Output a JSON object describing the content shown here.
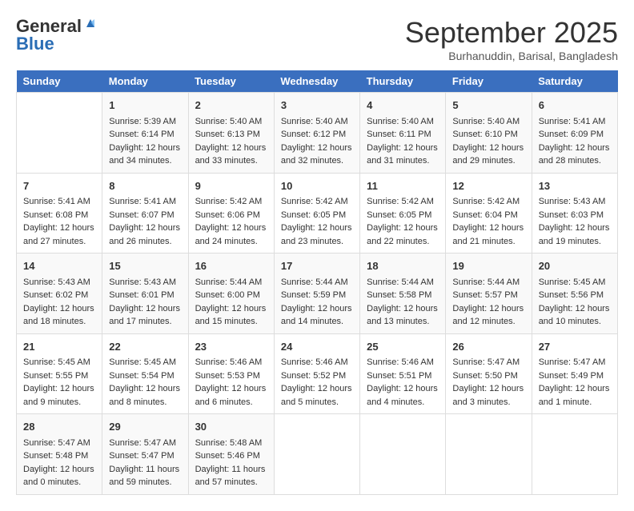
{
  "header": {
    "logo_general": "General",
    "logo_blue": "Blue",
    "month": "September 2025",
    "location": "Burhanuddin, Barisal, Bangladesh"
  },
  "columns": [
    "Sunday",
    "Monday",
    "Tuesday",
    "Wednesday",
    "Thursday",
    "Friday",
    "Saturday"
  ],
  "weeks": [
    [
      {
        "day": "",
        "info": ""
      },
      {
        "day": "1",
        "info": "Sunrise: 5:39 AM\nSunset: 6:14 PM\nDaylight: 12 hours\nand 34 minutes."
      },
      {
        "day": "2",
        "info": "Sunrise: 5:40 AM\nSunset: 6:13 PM\nDaylight: 12 hours\nand 33 minutes."
      },
      {
        "day": "3",
        "info": "Sunrise: 5:40 AM\nSunset: 6:12 PM\nDaylight: 12 hours\nand 32 minutes."
      },
      {
        "day": "4",
        "info": "Sunrise: 5:40 AM\nSunset: 6:11 PM\nDaylight: 12 hours\nand 31 minutes."
      },
      {
        "day": "5",
        "info": "Sunrise: 5:40 AM\nSunset: 6:10 PM\nDaylight: 12 hours\nand 29 minutes."
      },
      {
        "day": "6",
        "info": "Sunrise: 5:41 AM\nSunset: 6:09 PM\nDaylight: 12 hours\nand 28 minutes."
      }
    ],
    [
      {
        "day": "7",
        "info": "Sunrise: 5:41 AM\nSunset: 6:08 PM\nDaylight: 12 hours\nand 27 minutes."
      },
      {
        "day": "8",
        "info": "Sunrise: 5:41 AM\nSunset: 6:07 PM\nDaylight: 12 hours\nand 26 minutes."
      },
      {
        "day": "9",
        "info": "Sunrise: 5:42 AM\nSunset: 6:06 PM\nDaylight: 12 hours\nand 24 minutes."
      },
      {
        "day": "10",
        "info": "Sunrise: 5:42 AM\nSunset: 6:05 PM\nDaylight: 12 hours\nand 23 minutes."
      },
      {
        "day": "11",
        "info": "Sunrise: 5:42 AM\nSunset: 6:05 PM\nDaylight: 12 hours\nand 22 minutes."
      },
      {
        "day": "12",
        "info": "Sunrise: 5:42 AM\nSunset: 6:04 PM\nDaylight: 12 hours\nand 21 minutes."
      },
      {
        "day": "13",
        "info": "Sunrise: 5:43 AM\nSunset: 6:03 PM\nDaylight: 12 hours\nand 19 minutes."
      }
    ],
    [
      {
        "day": "14",
        "info": "Sunrise: 5:43 AM\nSunset: 6:02 PM\nDaylight: 12 hours\nand 18 minutes."
      },
      {
        "day": "15",
        "info": "Sunrise: 5:43 AM\nSunset: 6:01 PM\nDaylight: 12 hours\nand 17 minutes."
      },
      {
        "day": "16",
        "info": "Sunrise: 5:44 AM\nSunset: 6:00 PM\nDaylight: 12 hours\nand 15 minutes."
      },
      {
        "day": "17",
        "info": "Sunrise: 5:44 AM\nSunset: 5:59 PM\nDaylight: 12 hours\nand 14 minutes."
      },
      {
        "day": "18",
        "info": "Sunrise: 5:44 AM\nSunset: 5:58 PM\nDaylight: 12 hours\nand 13 minutes."
      },
      {
        "day": "19",
        "info": "Sunrise: 5:44 AM\nSunset: 5:57 PM\nDaylight: 12 hours\nand 12 minutes."
      },
      {
        "day": "20",
        "info": "Sunrise: 5:45 AM\nSunset: 5:56 PM\nDaylight: 12 hours\nand 10 minutes."
      }
    ],
    [
      {
        "day": "21",
        "info": "Sunrise: 5:45 AM\nSunset: 5:55 PM\nDaylight: 12 hours\nand 9 minutes."
      },
      {
        "day": "22",
        "info": "Sunrise: 5:45 AM\nSunset: 5:54 PM\nDaylight: 12 hours\nand 8 minutes."
      },
      {
        "day": "23",
        "info": "Sunrise: 5:46 AM\nSunset: 5:53 PM\nDaylight: 12 hours\nand 6 minutes."
      },
      {
        "day": "24",
        "info": "Sunrise: 5:46 AM\nSunset: 5:52 PM\nDaylight: 12 hours\nand 5 minutes."
      },
      {
        "day": "25",
        "info": "Sunrise: 5:46 AM\nSunset: 5:51 PM\nDaylight: 12 hours\nand 4 minutes."
      },
      {
        "day": "26",
        "info": "Sunrise: 5:47 AM\nSunset: 5:50 PM\nDaylight: 12 hours\nand 3 minutes."
      },
      {
        "day": "27",
        "info": "Sunrise: 5:47 AM\nSunset: 5:49 PM\nDaylight: 12 hours\nand 1 minute."
      }
    ],
    [
      {
        "day": "28",
        "info": "Sunrise: 5:47 AM\nSunset: 5:48 PM\nDaylight: 12 hours\nand 0 minutes."
      },
      {
        "day": "29",
        "info": "Sunrise: 5:47 AM\nSunset: 5:47 PM\nDaylight: 11 hours\nand 59 minutes."
      },
      {
        "day": "30",
        "info": "Sunrise: 5:48 AM\nSunset: 5:46 PM\nDaylight: 11 hours\nand 57 minutes."
      },
      {
        "day": "",
        "info": ""
      },
      {
        "day": "",
        "info": ""
      },
      {
        "day": "",
        "info": ""
      },
      {
        "day": "",
        "info": ""
      }
    ]
  ]
}
